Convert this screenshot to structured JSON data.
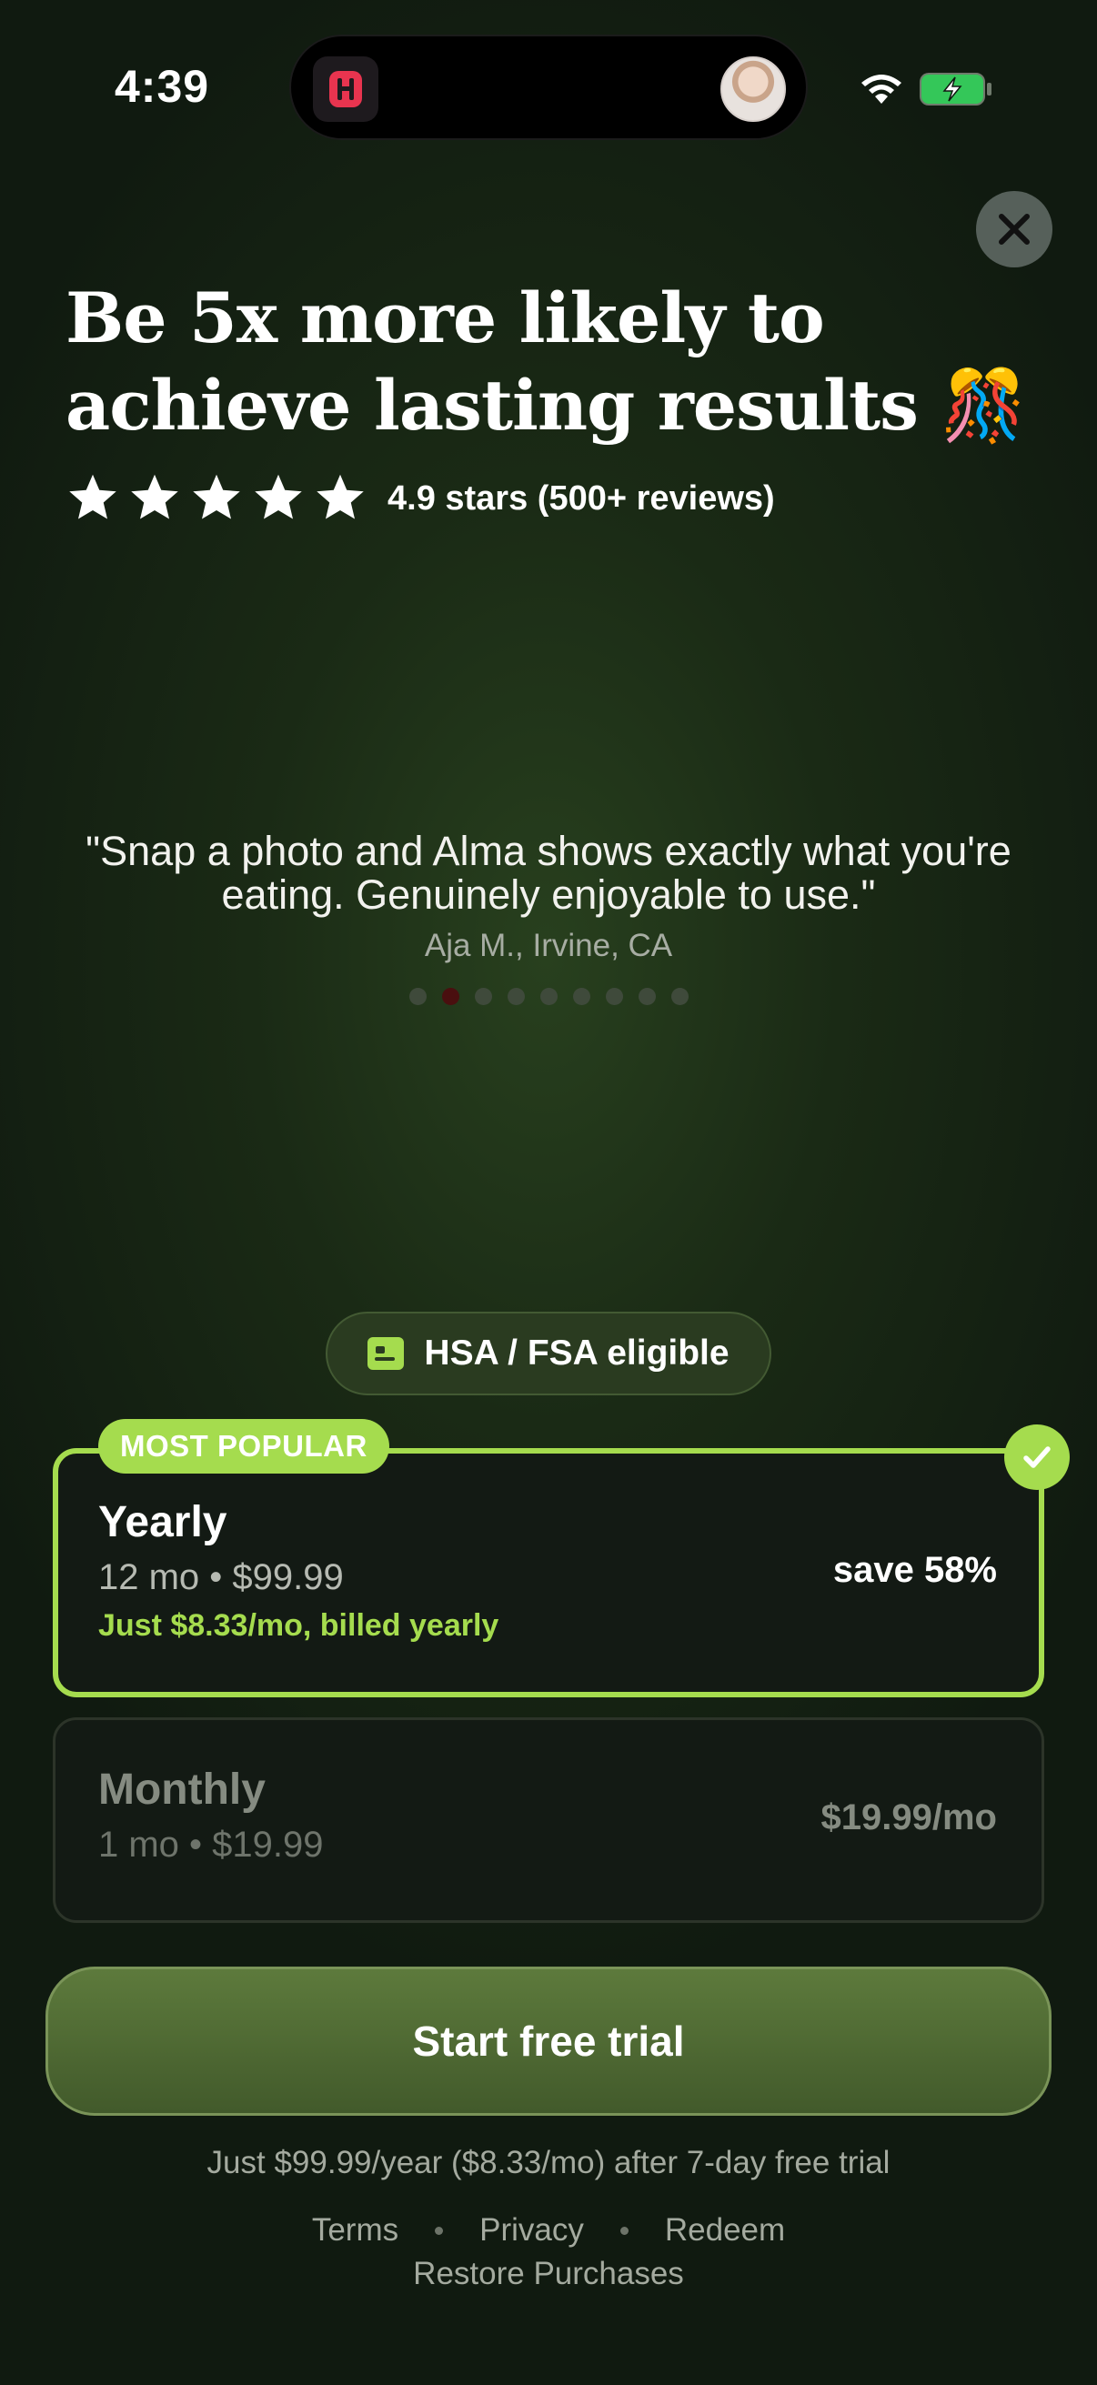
{
  "status_bar": {
    "time": "4:39",
    "icons": [
      "app-icon",
      "avatar",
      "wifi-icon",
      "battery-charging-icon"
    ]
  },
  "close": {
    "icon": "close-icon"
  },
  "headline": {
    "text": "Be 5x more likely to achieve lasting results",
    "emoji": "🎊"
  },
  "rating": {
    "stars": 5,
    "text": "4.9 stars (500+ reviews)"
  },
  "testimonial": {
    "quote": "\"Snap a photo and Alma shows exactly what you're eating. Genuinely enjoyable to use.\"",
    "author": "Aja M., Irvine, CA",
    "page_count": 9,
    "active_index": 1
  },
  "hsa_badge": {
    "label": "HSA / FSA eligible",
    "icon": "card-icon"
  },
  "plans": {
    "yearly": {
      "tag": "MOST POPULAR",
      "name": "Yearly",
      "sub": "12 mo • $99.99",
      "note": "Just $8.33/mo, billed yearly",
      "save": "save 58%",
      "selected": true
    },
    "monthly": {
      "name": "Monthly",
      "sub": "1 mo • $19.99",
      "price": "$19.99/mo",
      "selected": false
    }
  },
  "cta": {
    "label": "Start free trial"
  },
  "fine_print": "Just $99.99/year ($8.33/mo) after 7-day free trial",
  "footer": {
    "terms": "Terms",
    "privacy": "Privacy",
    "redeem": "Redeem",
    "restore": "Restore Purchases"
  },
  "colors": {
    "accent": "#a5dc4e",
    "cta": "#4f6a33",
    "background": "#1a2a15"
  }
}
